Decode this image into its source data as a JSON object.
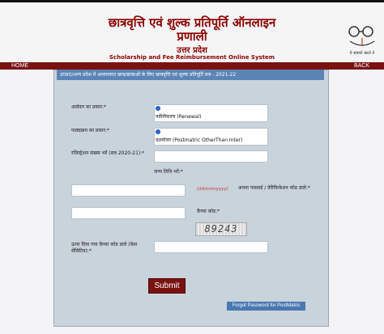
{
  "header": {
    "title_line1": "छात्रवृत्ति एवं शुल्क प्रतिपूर्ति ऑनलाइन",
    "title_line2": "प्रणाली",
    "state_hindi": "उत्तर प्रदेश",
    "subtitle": "Scholarship and Fee Reimbursement Online System",
    "logo_caption": "ये सबको खाले ते"
  },
  "nav": {
    "home": "HOME",
    "back": "BACK"
  },
  "panel": {
    "heading": "उ0प्र0/अन्य प्रदेश में अध्ययनरत छात्र/छात्राओं के लिए छात्रवृत्ति एवं शुल्क प्रतिपूर्ति सत्र - 2021-22"
  },
  "form": {
    "application_type_label": "आवेदन का प्रकार:*",
    "application_type_value": "नवीनीकरण (Renewal)",
    "course_type_label": "पाठ्यक्रम का प्रकार:*",
    "course_type_value": "दशमोत्तर (Postmatric OtherThan Inter)",
    "registration_label": "रजिस्ट्रेशन संख्या भरें (सत्र 2020-21):*",
    "dob_label": "जन्म तिथि भरें:*",
    "dob_hint": "(dd/mm/yyyy)",
    "password_label": "अपना पासवर्ड / वेरिफिकेशन कोड डाले:*",
    "captcha_label": "कैप्चा कोड:*",
    "captcha_code": "89243",
    "captcha_input_label": "ऊपर दिया गया कैप्चा कोड डाले (केस सेंसिटिव):*",
    "submit_label": "Submit",
    "forgot_label": "Forgot Password for PostMatric"
  },
  "colors": {
    "brand_maroon": "#7a1212",
    "panel_blue": "#5b84b6"
  }
}
